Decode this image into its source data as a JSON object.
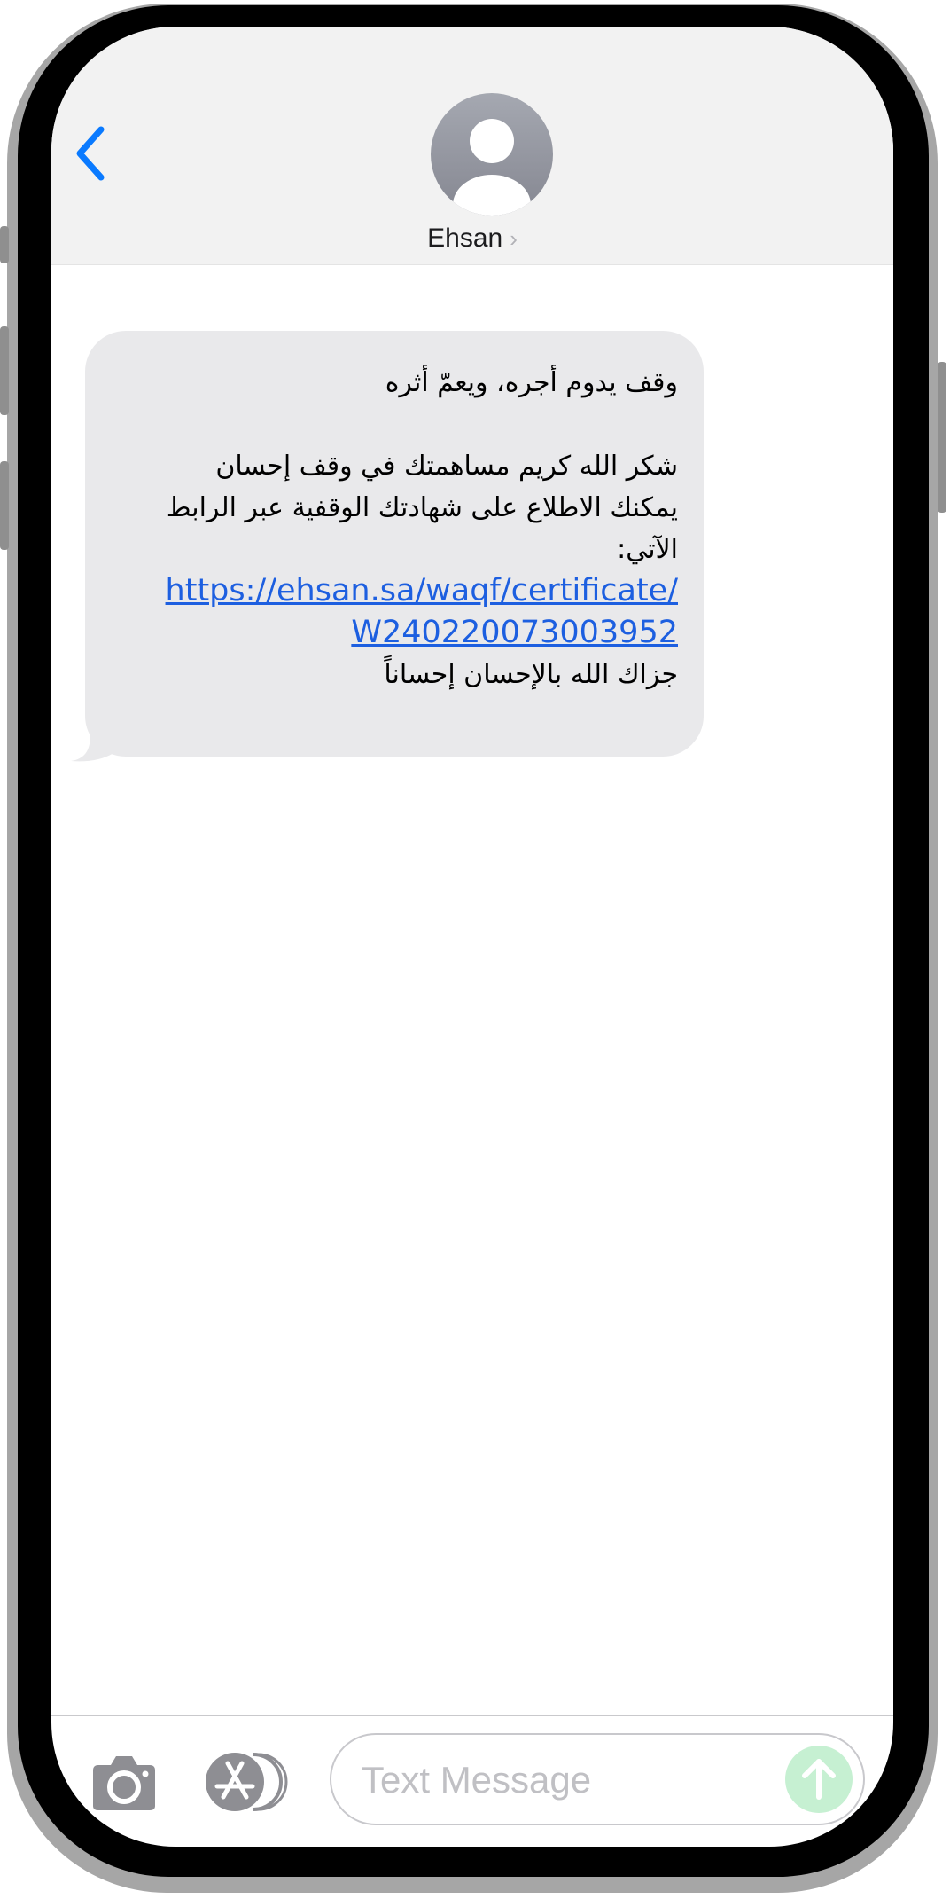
{
  "header": {
    "contact_name": "Ehsan",
    "name_chevron": "›",
    "back_icon": "chevron-left-icon",
    "avatar_icon": "person-silhouette-icon"
  },
  "message": {
    "line1": "وقف يدوم أجره، ويعمّ أثره",
    "line2": "شكر الله كريم مساهمتك في وقف إحسان",
    "line3": "يمكنك الاطلاع على شهادتك الوقفية عبر الرابط",
    "line4": "الآتي:",
    "link_part1": "https://ehsan.sa/waqf/certificate/",
    "link_part2": "W240220073003952",
    "line5": "جزاك الله بالإحسان إحساناً"
  },
  "composer": {
    "placeholder": "Text Message",
    "camera_icon": "camera-icon",
    "apps_icon": "app-store-icon",
    "send_icon": "arrow-up-icon"
  },
  "colors": {
    "accent": "#0a7aff",
    "link": "#1d5fe0",
    "bubble": "#e9e9eb",
    "send_button": "#c6f0d2"
  }
}
